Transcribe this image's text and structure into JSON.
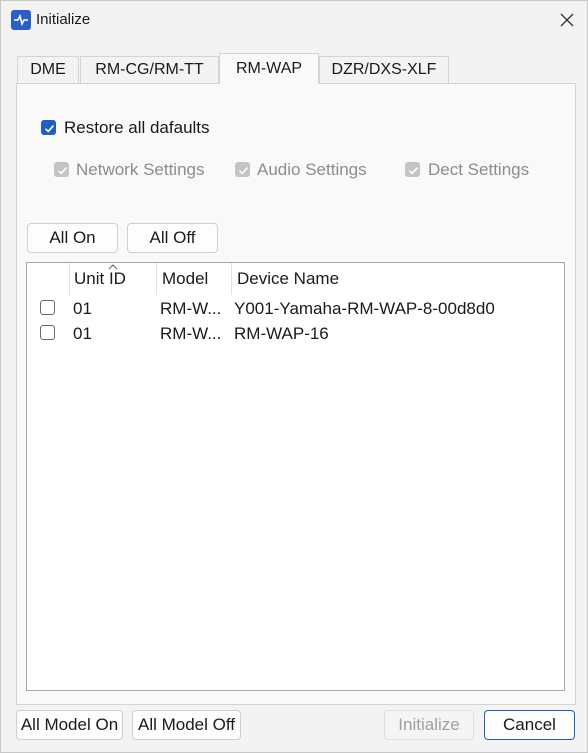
{
  "window": {
    "title": "Initialize"
  },
  "tabs": [
    {
      "label": "DME"
    },
    {
      "label": "RM-CG/RM-TT"
    },
    {
      "label": "RM-WAP"
    },
    {
      "label": "DZR/DXS-XLF"
    }
  ],
  "active_tab": "RM-WAP",
  "options": {
    "restore_all": {
      "label": "Restore all dafaults",
      "checked": true
    },
    "network": {
      "label": "Network Settings",
      "checked": true,
      "enabled": false
    },
    "audio": {
      "label": "Audio Settings",
      "checked": true,
      "enabled": false
    },
    "dect": {
      "label": "Dect Settings",
      "checked": true,
      "enabled": false
    }
  },
  "buttons": {
    "all_on": "All On",
    "all_off": "All Off",
    "all_model_on": "All Model On",
    "all_model_off": "All Model Off",
    "initialize": "Initialize",
    "cancel": "Cancel"
  },
  "table": {
    "columns": [
      "Unit ID",
      "Model",
      "Device Name"
    ],
    "sort_column": "Unit ID",
    "sort_direction": "ascending",
    "rows": [
      {
        "checked": false,
        "unit_id": "01",
        "model": "RM-W...",
        "device_name": "Y001-Yamaha-RM-WAP-8-00d8d0"
      },
      {
        "checked": false,
        "unit_id": "01",
        "model": "RM-W...",
        "device_name": "RM-WAP-16"
      }
    ]
  },
  "colors": {
    "accent": "#1f5fbf",
    "disabled": "#c4c4c4"
  }
}
